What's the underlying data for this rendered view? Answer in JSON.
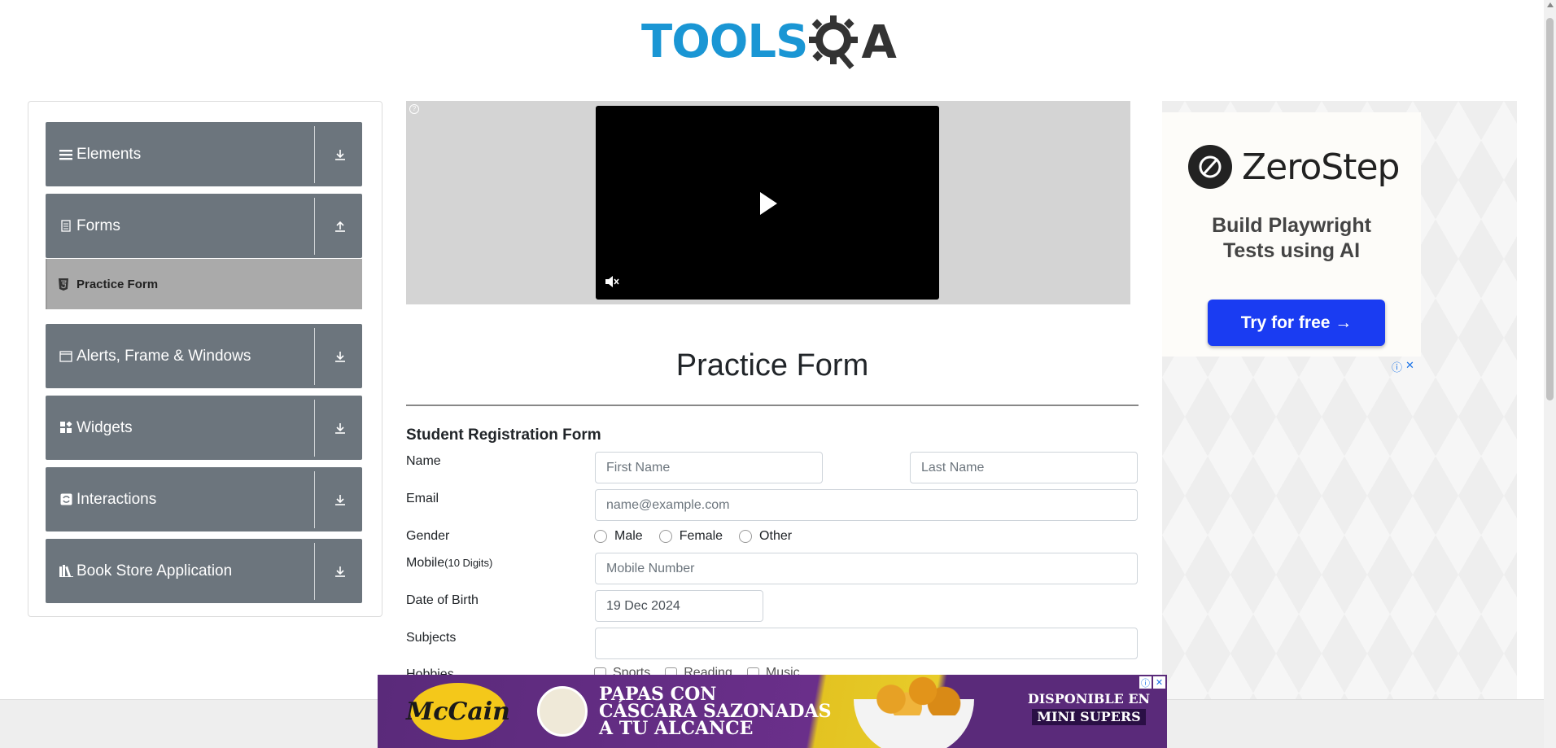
{
  "header": {
    "logo_text": "TOOLS",
    "logo_suffix": "A"
  },
  "sidebar": {
    "groups": [
      {
        "label": "Elements",
        "icon": "list-icon",
        "arrow": "download-icon"
      },
      {
        "label": "Forms",
        "icon": "document-icon",
        "arrow": "upload-icon"
      },
      {
        "label": "Alerts, Frame & Windows",
        "icon": "window-icon",
        "arrow": "download-icon"
      },
      {
        "label": "Widgets",
        "icon": "widgets-icon",
        "arrow": "download-icon"
      },
      {
        "label": "Interactions",
        "icon": "interactions-icon",
        "arrow": "download-icon"
      },
      {
        "label": "Book Store Application",
        "icon": "books-icon",
        "arrow": "download-icon"
      }
    ],
    "active_subitem": {
      "label": "Practice Form",
      "icon": "html5-icon"
    }
  },
  "main": {
    "title": "Practice Form",
    "form_heading": "Student Registration Form",
    "labels": {
      "name": "Name",
      "email": "Email",
      "gender": "Gender",
      "mobile": "Mobile",
      "mobile_hint": "(10 Digits)",
      "dob": "Date of Birth",
      "subjects": "Subjects",
      "hobbies": "Hobbies"
    },
    "placeholders": {
      "first_name": "First Name",
      "last_name": "Last Name",
      "email": "name@example.com",
      "mobile": "Mobile Number"
    },
    "values": {
      "dob": "19 Dec 2024",
      "subjects": ""
    },
    "gender_options": [
      "Male",
      "Female",
      "Other"
    ],
    "hobby_options": [
      "Sports",
      "Reading",
      "Music"
    ]
  },
  "right_ad": {
    "brand": "ZeroStep",
    "tagline_1": "Build Playwright",
    "tagline_2": "Tests using AI",
    "cta": "Try for free →",
    "choices_info": "ⓘ",
    "choices_close": "✕"
  },
  "bottom_ad": {
    "logo": "McCain",
    "headline_1": "PAPAS CON",
    "headline_2": "CÁSCARA SAZONADAS",
    "headline_3": "A TU ALCANCE",
    "avail_1": "DISPONIBLE EN",
    "avail_2": "MINI SUPERS",
    "info": "ⓘ",
    "close": "✕"
  },
  "colors": {
    "brand_blue": "#1a96d4",
    "sidebar_group": "#6c757d",
    "sidebar_active": "#aaaaaa",
    "cta_blue": "#1a3cf2",
    "banner_purple": "#5a2a7a"
  }
}
